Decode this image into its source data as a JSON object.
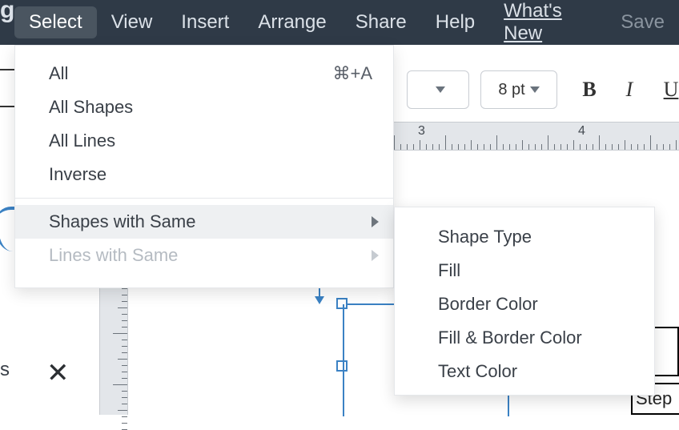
{
  "menubar": {
    "items": [
      {
        "label": "Select"
      },
      {
        "label": "View"
      },
      {
        "label": "Insert"
      },
      {
        "label": "Arrange"
      },
      {
        "label": "Share"
      },
      {
        "label": "Help"
      },
      {
        "label": "What's New"
      },
      {
        "label": "Save"
      }
    ]
  },
  "toolbar": {
    "font_size": "8 pt",
    "bold": "B",
    "italic": "I",
    "underline": "U"
  },
  "ruler": {
    "marks": [
      "3",
      "4"
    ]
  },
  "select_menu": {
    "all": "All",
    "all_shortcut": "⌘+A",
    "all_shapes": "All Shapes",
    "all_lines": "All Lines",
    "inverse": "Inverse",
    "shapes_same": "Shapes with Same",
    "lines_same": "Lines with Same"
  },
  "submenu": {
    "shape_type": "Shape Type",
    "fill": "Fill",
    "border_color": "Border Color",
    "fill_border": "Fill & Border Color",
    "text_color": "Text Color"
  },
  "canvas": {
    "step_label": "Step",
    "left_frag": "s",
    "g_frag": "g",
    "close_x": "✕"
  }
}
